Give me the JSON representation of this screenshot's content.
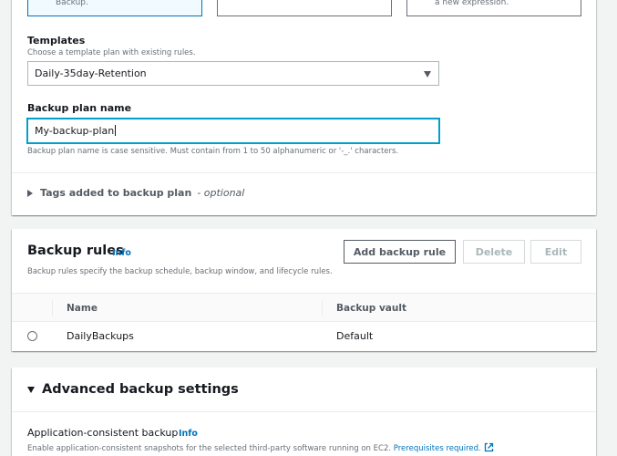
{
  "plan_options": {
    "tile1_text": "Backup.",
    "tile3_text": "a new expression."
  },
  "templates": {
    "label": "Templates",
    "description": "Choose a template plan with existing rules.",
    "selected": "Daily-35day-Retention"
  },
  "plan_name": {
    "label": "Backup plan name",
    "value": "My-backup-plan",
    "hint": "Backup plan name is case sensitive. Must contain from 1 to 50 alphanumeric or '-_.' characters."
  },
  "tags": {
    "label": "Tags added to backup plan",
    "optional": "- optional"
  },
  "backup_rules": {
    "title": "Backup rules",
    "info": "Info",
    "description": "Backup rules specify the backup schedule, backup window, and lifecycle rules.",
    "add_label": "Add backup rule",
    "delete_label": "Delete",
    "edit_label": "Edit",
    "columns": [
      "Name",
      "Backup vault"
    ],
    "rows": [
      {
        "name": "DailyBackups",
        "vault": "Default"
      }
    ]
  },
  "advanced": {
    "title": "Advanced backup settings",
    "app_consistent_label": "Application-consistent backup",
    "info": "Info",
    "app_consistent_desc": "Enable application-consistent snapshots for the selected third-party software running on EC2.",
    "prereq_link": "Prerequisites required."
  },
  "colors": {
    "link": "#0073bb",
    "focus": "#00a1c9",
    "selected_tile": "#f1faff"
  }
}
